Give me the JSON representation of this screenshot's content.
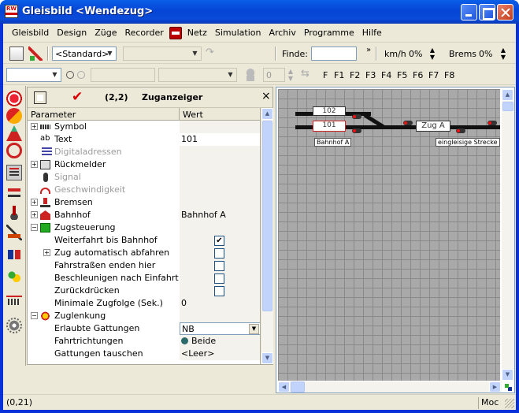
{
  "window": {
    "title": "Gleisbild <Wendezug>",
    "app_icon_text": "RW"
  },
  "menu": [
    "Gleisbild",
    "Design",
    "Züge",
    "Recorder",
    "Netz",
    "Simulation",
    "Archiv",
    "Programme",
    "Hilfe"
  ],
  "toolbar1": {
    "style_combo": "<Standard>",
    "find_label": "Finde:",
    "find_value": "",
    "speed_unit": "km/h",
    "speed_value": "0%",
    "brake_label": "Brems",
    "brake_value": "0%"
  },
  "toolbar2": {
    "step_value": "0",
    "function_keys": [
      "F",
      "F1",
      "F2",
      "F3",
      "F4",
      "F5",
      "F6",
      "F7",
      "F8"
    ]
  },
  "panel": {
    "coords": "(2,2)",
    "title": "Zuganzeiger",
    "close": "×",
    "col_param": "Parameter",
    "col_value": "Wert",
    "rows": [
      {
        "label": "Symbol",
        "value": ""
      },
      {
        "label": "Text",
        "value": "101"
      },
      {
        "label": "Digitaladressen",
        "value": ""
      },
      {
        "label": "Rückmelder",
        "value": ""
      },
      {
        "label": "Signal",
        "value": ""
      },
      {
        "label": "Geschwindigkeit",
        "value": ""
      },
      {
        "label": "Bremsen",
        "value": ""
      },
      {
        "label": "Bahnhof",
        "value": "Bahnhof A"
      },
      {
        "label": "Zugsteuerung",
        "value": ""
      },
      {
        "label": "Weiterfahrt bis Bahnhof",
        "value": "✔"
      },
      {
        "label": "Zug automatisch abfahren",
        "value": ""
      },
      {
        "label": "Fahrstraßen enden hier",
        "value": ""
      },
      {
        "label": "Beschleunigen nach Einfahrt",
        "value": ""
      },
      {
        "label": "Zurückdrücken",
        "value": ""
      },
      {
        "label": "Minimale Zugfolge (Sek.)",
        "value": "0"
      },
      {
        "label": "Zuglenkung",
        "value": ""
      },
      {
        "label": "Erlaubte Gattungen",
        "value": "NB"
      },
      {
        "label": "Fahrtrichtungen",
        "value": "Beide"
      },
      {
        "label": "Gattungen tauschen",
        "value": "<Leer>"
      }
    ]
  },
  "map": {
    "box_top": "102",
    "box_bottom": "101",
    "train_label": "Zug A",
    "station_label": "Bahnhof A",
    "track_label": "eingleisige Strecke"
  },
  "status": {
    "coords": "(0,21)",
    "mode": "Moc"
  }
}
